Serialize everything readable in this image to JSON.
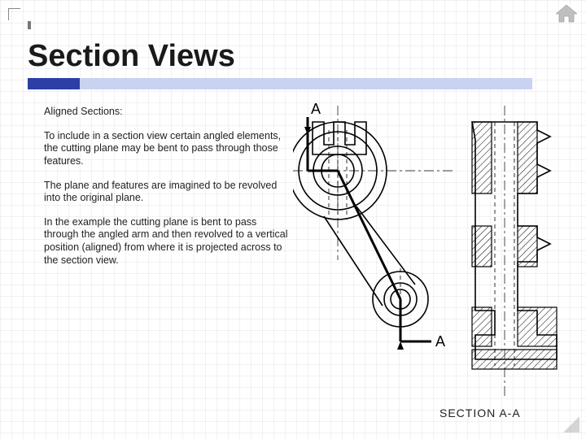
{
  "slide": {
    "title": "Section Views",
    "subheading": "Aligned Sections:",
    "paragraphs": [
      "To include in a section view certain angled elements, the cutting plane may be bent to pass through those features.",
      "The plane and features are imagined to be revolved into the original plane.",
      "In the example the cutting plane is bent to pass through the angled arm and then revolved to a vertical position (aligned) from where it is projected across to the section view."
    ],
    "figure": {
      "label_top": "A",
      "label_bottom": "A",
      "caption": "SECTION A-A",
      "description": "Engineering drawing: plan view of a bracket with an angled arm showing a bent cutting-plane line A-A, and the corresponding aligned section view to the right with hatching."
    },
    "icons": {
      "home": "home-icon"
    }
  }
}
